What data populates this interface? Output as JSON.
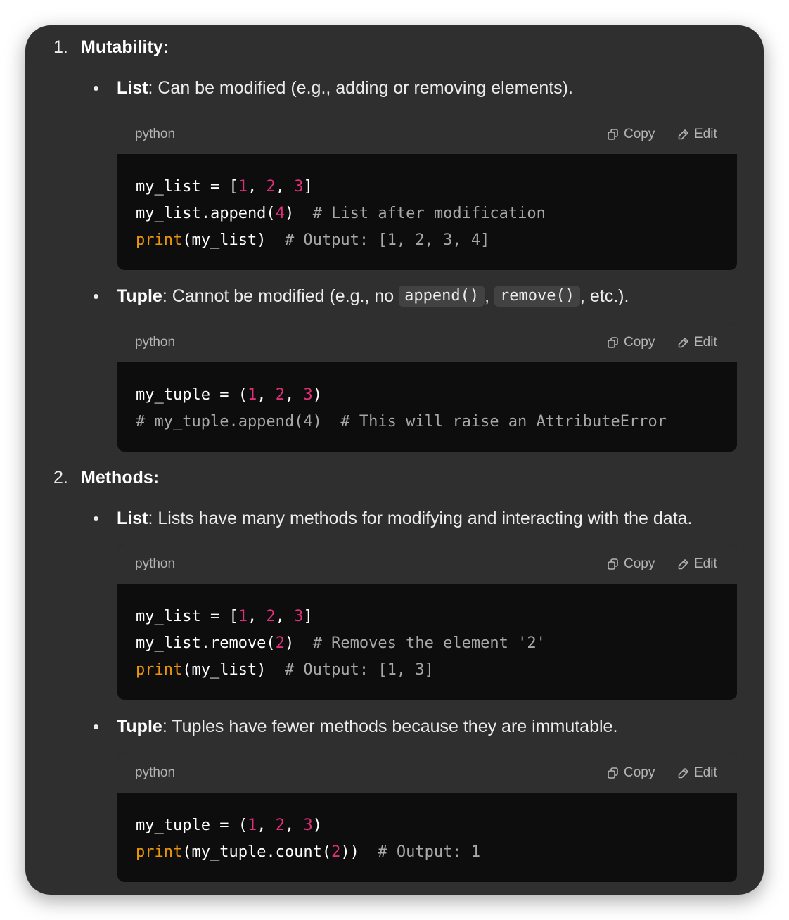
{
  "sections": [
    {
      "number": "1.",
      "title": "Mutability",
      "colon": ":",
      "items": [
        {
          "label": "List",
          "sep": ": ",
          "text": "Can be modified (e.g., adding or removing elements).",
          "code": {
            "lang": "python",
            "copy_label": "Copy",
            "edit_label": "Edit",
            "lines": [
              [
                {
                  "t": "my_list = [",
                  "c": "plain"
                },
                {
                  "t": "1",
                  "c": "num"
                },
                {
                  "t": ", ",
                  "c": "plain"
                },
                {
                  "t": "2",
                  "c": "num"
                },
                {
                  "t": ", ",
                  "c": "plain"
                },
                {
                  "t": "3",
                  "c": "num"
                },
                {
                  "t": "]",
                  "c": "plain"
                }
              ],
              [
                {
                  "t": "my_list.append(",
                  "c": "plain"
                },
                {
                  "t": "4",
                  "c": "num"
                },
                {
                  "t": ")  ",
                  "c": "plain"
                },
                {
                  "t": "# List after modification",
                  "c": "cm"
                }
              ],
              [
                {
                  "t": "print",
                  "c": "fn"
                },
                {
                  "t": "(my_list)  ",
                  "c": "plain"
                },
                {
                  "t": "# Output: [1, 2, 3, 4]",
                  "c": "cm"
                }
              ]
            ]
          }
        },
        {
          "label": "Tuple",
          "sep": ": ",
          "text_before": "Cannot be modified (e.g., no ",
          "inline_code_1": "append()",
          "text_mid": ", ",
          "inline_code_2": "remove()",
          "text_after": ", etc.).",
          "code": {
            "lang": "python",
            "copy_label": "Copy",
            "edit_label": "Edit",
            "lines": [
              [
                {
                  "t": "my_tuple = (",
                  "c": "plain"
                },
                {
                  "t": "1",
                  "c": "num"
                },
                {
                  "t": ", ",
                  "c": "plain"
                },
                {
                  "t": "2",
                  "c": "num"
                },
                {
                  "t": ", ",
                  "c": "plain"
                },
                {
                  "t": "3",
                  "c": "num"
                },
                {
                  "t": ")",
                  "c": "plain"
                }
              ],
              [
                {
                  "t": "# my_tuple.append(4)  # This will raise an AttributeError",
                  "c": "cm"
                }
              ]
            ]
          }
        }
      ]
    },
    {
      "number": "2.",
      "title": "Methods",
      "colon": ":",
      "items": [
        {
          "label": "List",
          "sep": ": ",
          "text": "Lists have many methods for modifying and interacting with the data.",
          "code": {
            "lang": "python",
            "copy_label": "Copy",
            "edit_label": "Edit",
            "lines": [
              [
                {
                  "t": "my_list = [",
                  "c": "plain"
                },
                {
                  "t": "1",
                  "c": "num"
                },
                {
                  "t": ", ",
                  "c": "plain"
                },
                {
                  "t": "2",
                  "c": "num"
                },
                {
                  "t": ", ",
                  "c": "plain"
                },
                {
                  "t": "3",
                  "c": "num"
                },
                {
                  "t": "]",
                  "c": "plain"
                }
              ],
              [
                {
                  "t": "my_list.remove(",
                  "c": "plain"
                },
                {
                  "t": "2",
                  "c": "num"
                },
                {
                  "t": ")  ",
                  "c": "plain"
                },
                {
                  "t": "# Removes the element '2'",
                  "c": "cm"
                }
              ],
              [
                {
                  "t": "print",
                  "c": "fn"
                },
                {
                  "t": "(my_list)  ",
                  "c": "plain"
                },
                {
                  "t": "# Output: [1, 3]",
                  "c": "cm"
                }
              ]
            ]
          }
        },
        {
          "label": "Tuple",
          "sep": ": ",
          "text": "Tuples have fewer methods because they are immutable.",
          "code": {
            "lang": "python",
            "copy_label": "Copy",
            "edit_label": "Edit",
            "lines": [
              [
                {
                  "t": "my_tuple = (",
                  "c": "plain"
                },
                {
                  "t": "1",
                  "c": "num"
                },
                {
                  "t": ", ",
                  "c": "plain"
                },
                {
                  "t": "2",
                  "c": "num"
                },
                {
                  "t": ", ",
                  "c": "plain"
                },
                {
                  "t": "3",
                  "c": "num"
                },
                {
                  "t": ")",
                  "c": "plain"
                }
              ],
              [
                {
                  "t": "print",
                  "c": "fn"
                },
                {
                  "t": "(my_tuple.count(",
                  "c": "plain"
                },
                {
                  "t": "2",
                  "c": "num"
                },
                {
                  "t": "))  ",
                  "c": "plain"
                },
                {
                  "t": "# Output: 1",
                  "c": "cm"
                }
              ]
            ]
          }
        }
      ]
    }
  ],
  "colors": {
    "background": "#2f2f2f",
    "code_background": "#0d0d0d",
    "number_token": "#df3079",
    "builtin_token": "#e9950c",
    "comment_token": "#a8a8a8"
  },
  "icons": {
    "copy": "copy-icon",
    "edit": "pencil-icon"
  }
}
